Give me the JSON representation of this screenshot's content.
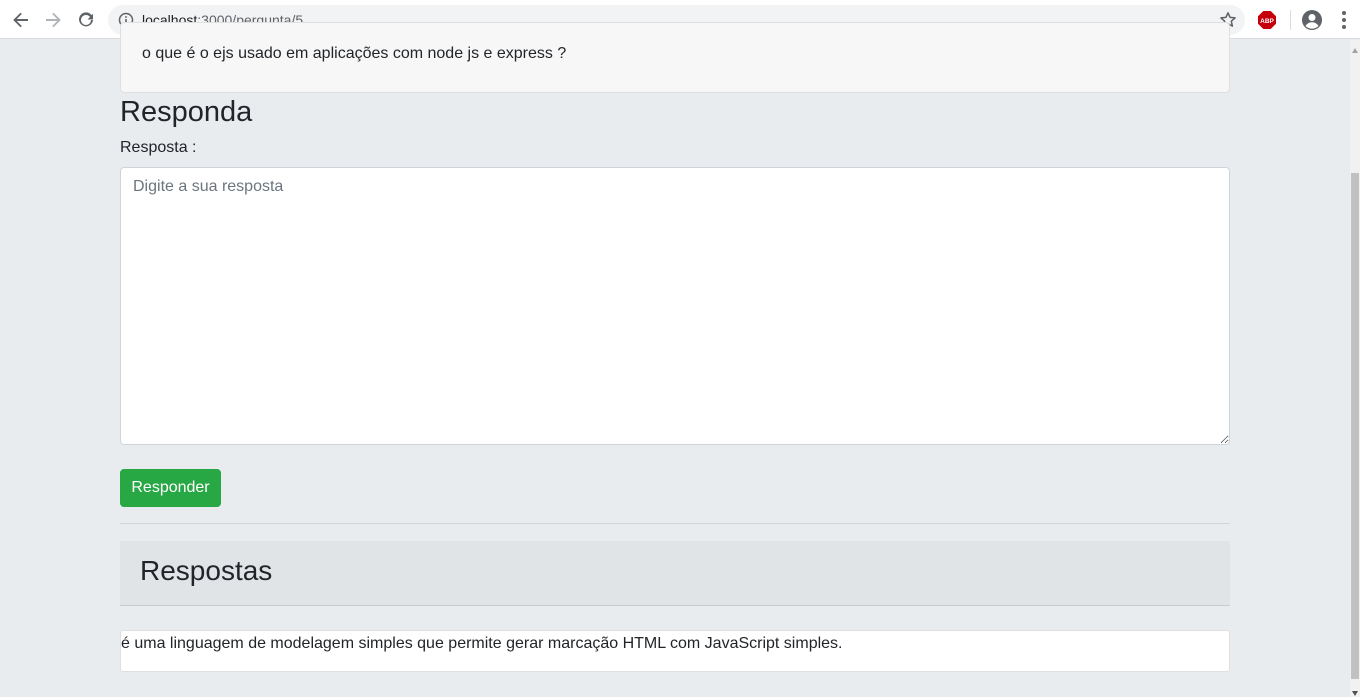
{
  "browser": {
    "url_host": "localhost",
    "url_path": ":3000/pergunta/5",
    "back_icon": "arrow-left-icon",
    "forward_icon": "arrow-right-icon",
    "reload_icon": "reload-icon",
    "info_icon": "info-icon",
    "bookmark_icon": "star-icon",
    "extension_label": "ABP",
    "profile_icon": "account-circle-icon",
    "menu_icon": "kebab-menu-icon"
  },
  "question": {
    "text": "o que é o ejs usado em aplicações com node js e express ?"
  },
  "answer_form": {
    "title": "Responda",
    "label": "Resposta :",
    "placeholder": "Digite a sua resposta",
    "value": "",
    "submit_label": "Responder",
    "submit_color": "#28a745"
  },
  "answers_section": {
    "title": "Respostas",
    "items": [
      {
        "text": "é uma linguagem de modelagem simples que permite gerar marcação HTML com JavaScript simples."
      }
    ]
  }
}
